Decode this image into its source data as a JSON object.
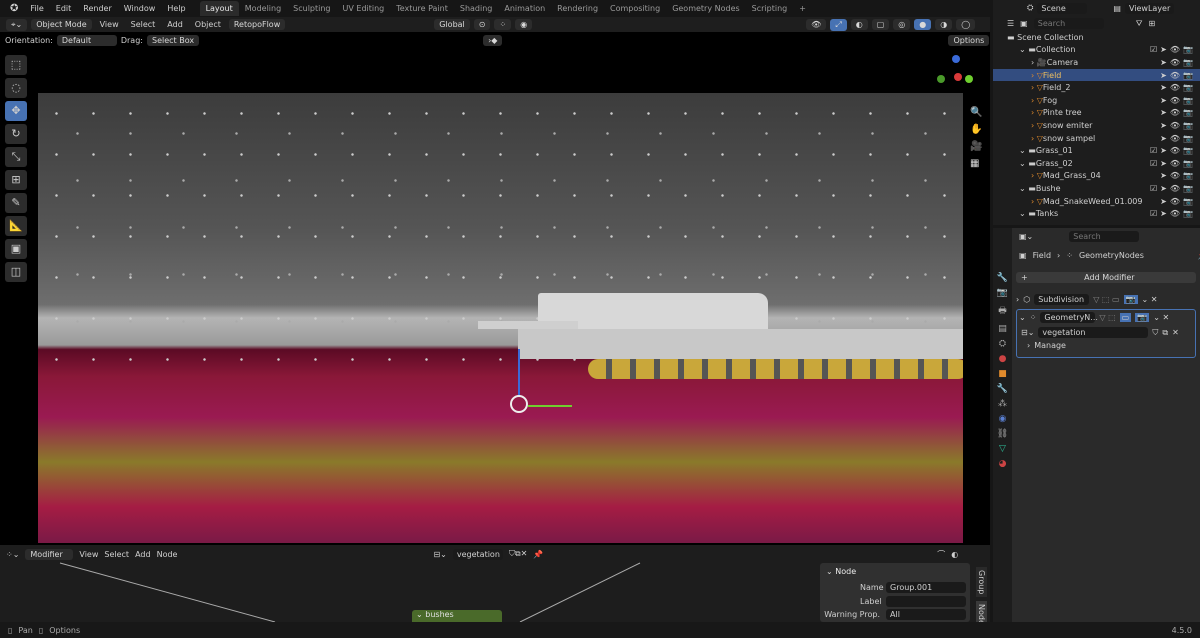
{
  "menu": {
    "items": [
      "File",
      "Edit",
      "Render",
      "Window",
      "Help"
    ]
  },
  "workspaces": [
    "Layout",
    "Modeling",
    "Sculpting",
    "UV Editing",
    "Texture Paint",
    "Shading",
    "Animation",
    "Rendering",
    "Compositing",
    "Geometry Nodes",
    "Scripting"
  ],
  "active_workspace": "Layout",
  "scene": {
    "name": "Scene",
    "view_layer": "ViewLayer"
  },
  "header": {
    "mode": "Object Mode",
    "menus": [
      "View",
      "Select",
      "Add",
      "Object"
    ],
    "addon": "RetopoFlow",
    "transform": "Global"
  },
  "tool_settings": {
    "orientation_label": "Orientation:",
    "orientation": "Default",
    "drag_label": "Drag:",
    "drag": "Select Box",
    "options": "Options"
  },
  "outliner": {
    "search_placeholder": "Search",
    "root": "Scene Collection",
    "rows": [
      {
        "name": "Collection",
        "depth": 1,
        "type": "collection"
      },
      {
        "name": "Camera",
        "depth": 2,
        "type": "camera"
      },
      {
        "name": "Field",
        "depth": 2,
        "type": "mesh",
        "selected": true
      },
      {
        "name": "Field_2",
        "depth": 2,
        "type": "mesh"
      },
      {
        "name": "Fog",
        "depth": 2,
        "type": "mesh"
      },
      {
        "name": "Pinte tree",
        "depth": 2,
        "type": "mesh"
      },
      {
        "name": "snow emiter",
        "depth": 2,
        "type": "mesh"
      },
      {
        "name": "snow sampel",
        "depth": 2,
        "type": "mesh"
      },
      {
        "name": "Grass_01",
        "depth": 1,
        "type": "collection"
      },
      {
        "name": "Grass_02",
        "depth": 1,
        "type": "collection"
      },
      {
        "name": "Mad_Grass_04",
        "depth": 2,
        "type": "mesh"
      },
      {
        "name": "Bushe",
        "depth": 1,
        "type": "collection"
      },
      {
        "name": "Mad_SnakeWeed_01.009",
        "depth": 2,
        "type": "mesh"
      },
      {
        "name": "Tanks",
        "depth": 1,
        "type": "collection"
      }
    ]
  },
  "properties": {
    "search_placeholder": "Search",
    "breadcrumb_object": "Field",
    "breadcrumb_modifier": "GeometryNodes",
    "add_modifier": "Add Modifier",
    "modifiers": [
      {
        "name": "Subdivision",
        "expanded": false
      },
      {
        "name": "GeometryN...",
        "expanded": true
      }
    ],
    "node_group": "vegetation",
    "manage": "Manage"
  },
  "node_editor": {
    "context": "Modifier",
    "menus": [
      "View",
      "Select",
      "Add",
      "Node"
    ],
    "node_group": "vegetation",
    "node_frame": "bushes",
    "panel": {
      "title": "Node",
      "name_label": "Name",
      "name_value": "Group.001",
      "label_label": "Label",
      "label_value": "",
      "warning_label": "Warning Prop.",
      "warning_value": "All"
    },
    "side_tabs": [
      "Group",
      "Node"
    ]
  },
  "status": {
    "pan": "Pan",
    "options": "Options",
    "version": "4.5.0"
  },
  "colors": {
    "accent": "#4772b3",
    "selected_row": "#334d80",
    "mesh_icon": "#e08a2c",
    "modifier_icon": "#5a7fd0",
    "geometry_icon": "#2fbf9a",
    "node_frame": "#4a6a2a"
  }
}
